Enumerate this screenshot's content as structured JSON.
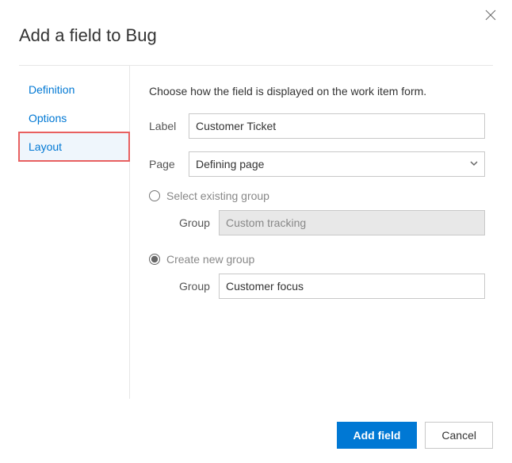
{
  "dialog": {
    "title": "Add a field to Bug"
  },
  "sidebar": {
    "tabs": [
      {
        "label": "Definition"
      },
      {
        "label": "Options"
      },
      {
        "label": "Layout"
      }
    ]
  },
  "content": {
    "intro": "Choose how the field is displayed on the work item form.",
    "label_field_label": "Label",
    "label_field_value": "Customer Ticket",
    "page_field_label": "Page",
    "page_field_value": "Defining page",
    "select_existing_label": "Select existing group",
    "existing_group_label": "Group",
    "existing_group_value": "Custom tracking",
    "create_new_label": "Create new group",
    "new_group_label": "Group",
    "new_group_value": "Customer focus"
  },
  "footer": {
    "primary_label": "Add field",
    "cancel_label": "Cancel"
  }
}
